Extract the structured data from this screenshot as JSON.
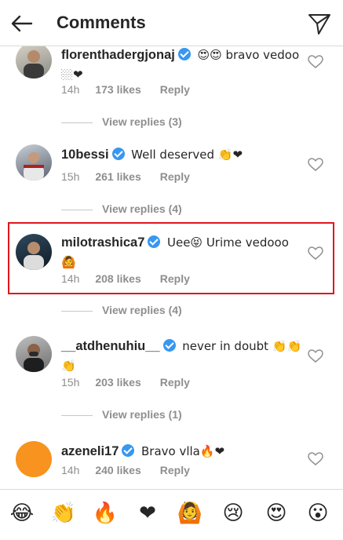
{
  "header": {
    "title": "Comments"
  },
  "comments": [
    {
      "username": "florenthadergjonaj",
      "text": "😍😍 bravo vedoo🏼❤",
      "time": "14h",
      "likes": "173 likes",
      "reply_label": "Reply",
      "view_replies": "View replies (3)"
    },
    {
      "username": "10bessi",
      "text": "Well deserved 👏❤",
      "time": "15h",
      "likes": "261 likes",
      "reply_label": "Reply",
      "view_replies": "View replies (4)"
    },
    {
      "username": "milotrashica7",
      "text": "Uee😝 Urime vedooo 🙆",
      "time": "14h",
      "likes": "208 likes",
      "reply_label": "Reply",
      "view_replies": "View replies (4)"
    },
    {
      "username": "__atdhenuhiu__",
      "text": "never in doubt 👏👏👏",
      "time": "15h",
      "likes": "203 likes",
      "reply_label": "Reply",
      "view_replies": "View replies (1)"
    },
    {
      "username": "azeneli17",
      "text": "Bravo vlla🔥❤",
      "time": "14h",
      "likes": "240 likes",
      "reply_label": "Reply"
    }
  ],
  "emoji_bar": [
    "😂",
    "👏",
    "🔥",
    "❤",
    "🙆",
    "😢",
    "😍",
    "😮"
  ],
  "colors": {
    "verified": "#3897f0",
    "highlight": "#e0161d",
    "secondary_text": "#8e8e8e"
  }
}
